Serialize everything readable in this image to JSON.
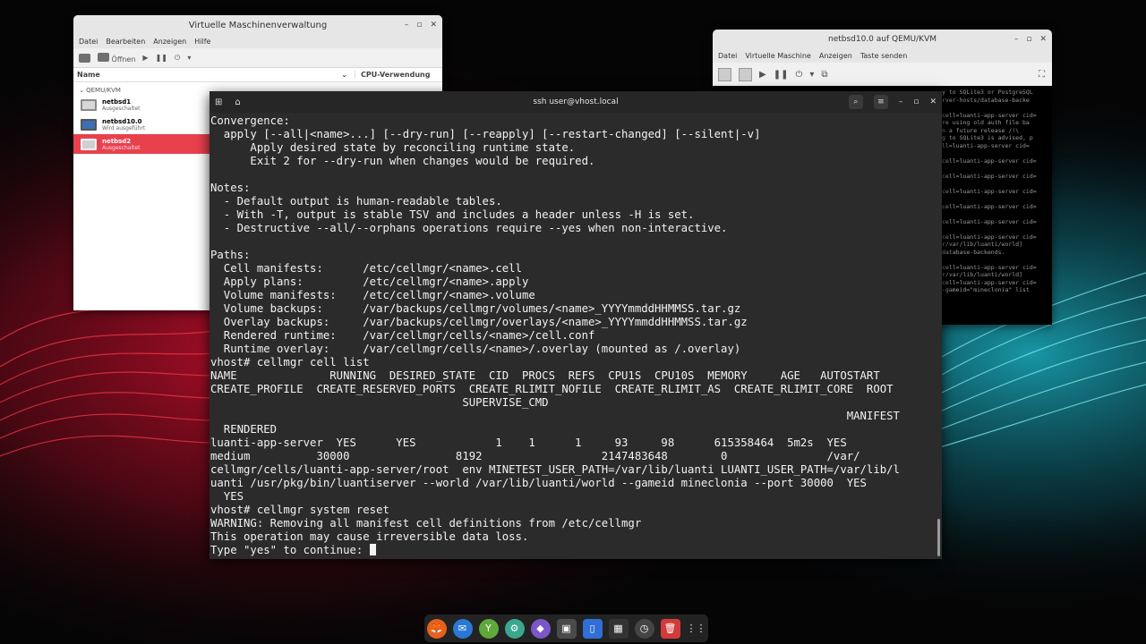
{
  "vmm": {
    "title": "Virtuelle Maschinenverwaltung",
    "menu": [
      "Datei",
      "Bearbeiten",
      "Anzeigen",
      "Hilfe"
    ],
    "toolbar": {
      "open": "Öffnen"
    },
    "columns": {
      "name": "Name",
      "cpu": "CPU-Verwendung"
    },
    "group": "QEMU/KVM",
    "vms": [
      {
        "name": "netbsd1",
        "state": "Ausgeschaltet"
      },
      {
        "name": "netbsd10.0",
        "state": "Wird ausgeführt"
      },
      {
        "name": "netbsd2",
        "state": "Ausgeschaltet"
      }
    ]
  },
  "qemu": {
    "title": "netbsd10.0 auf QEMU/KVM",
    "menu": [
      "Datei",
      "Virtuelle Maschine",
      "Anzeigen",
      "Taste senden"
    ],
    "console_lines": [
      "y to SQLite3 or PostgreSQL",
      "rver-hosts/database-backe",
      "",
      "cell=luanti-app-server cid=",
      "re using old auth file ba",
      "n a future release /!\\",
      "g to SQLite3 is advised, p",
      "ll=luanti-app-server cid=",
      "",
      "cell=luanti-app-server cid=",
      "",
      "cell=luanti-app-server cid=",
      "",
      "cell=luanti-app-server cid=",
      "",
      "cell=luanti-app-server cid=",
      "",
      "cell=luanti-app-server cid=",
      "",
      "cell=luanti-app-server cid=",
      "r/var/lib/luanti/world]",
      "database-backends.",
      "",
      "cell=luanti-app-server cid=",
      "r/var/lib/luanti/world]",
      "cell=luanti-app-server cid=",
      "-gameid=\"mineclonia\" list"
    ]
  },
  "terminal": {
    "title": "ssh user@vhost.local",
    "lines": [
      "Convergence:",
      "  apply [--all|<name>...] [--dry-run] [--reapply] [--restart-changed] [--silent|-v]",
      "      Apply desired state by reconciling runtime state.",
      "      Exit 2 for --dry-run when changes would be required.",
      "",
      "Notes:",
      "  - Default output is human-readable tables.",
      "  - With -T, output is stable TSV and includes a header unless -H is set.",
      "  - Destructive --all/--orphans operations require --yes when non-interactive.",
      "",
      "Paths:",
      "  Cell manifests:      /etc/cellmgr/<name>.cell",
      "  Apply plans:         /etc/cellmgr/<name>.apply",
      "  Volume manifests:    /etc/cellmgr/<name>.volume",
      "  Volume backups:      /var/backups/cellmgr/volumes/<name>_YYYYmmddHHMMSS.tar.gz",
      "  Overlay backups:     /var/backups/cellmgr/overlays/<name>_YYYYmmddHHMMSS.tar.gz",
      "  Rendered runtime:    /var/cellmgr/cells/<name>/cell.conf",
      "  Runtime overlay:     /var/cellmgr/cells/<name>/.overlay (mounted as /.overlay)",
      "vhost# cellmgr cell list",
      "NAME              RUNNING  DESIRED_STATE  CID  PROCS  REFS  CPU1S  CPU10S  MEMORY     AGE   AUTOSTART",
      "CREATE_PROFILE  CREATE_RESERVED_PORTS  CREATE_RLIMIT_NOFILE  CREATE_RLIMIT_AS  CREATE_RLIMIT_CORE  ROOT",
      "                                      SUPERVISE_CMD",
      "                                                                                                MANIFEST",
      "  RENDERED",
      "luanti-app-server  YES      YES            1    1      1     93     98      615358464  5m2s  YES",
      "medium          30000                8192                  2147483648        0               /var/",
      "cellmgr/cells/luanti-app-server/root  env MINETEST_USER_PATH=/var/lib/luanti LUANTI_USER_PATH=/var/lib/l",
      "uanti /usr/pkg/bin/luantiserver --world /var/lib/luanti/world --gameid mineclonia --port 30000  YES",
      "  YES",
      "vhost# cellmgr system reset",
      "WARNING: Removing all manifest cell definitions from /etc/cellmgr",
      "This operation may cause irreversible data loss.",
      "Type \"yes\" to continue: "
    ]
  },
  "colors": {
    "terminal_bg": "#2b2b2b",
    "terminal_fg": "#f2f2f2",
    "selection": "#e8414d"
  },
  "dock": {
    "icons": [
      "firefox-icon",
      "thunderbird-icon",
      "vim-icon",
      "settings-icon",
      "package-icon",
      "terminal-icon",
      "phone-icon",
      "virt-manager-icon",
      "clock-icon",
      "trash-icon",
      "app-grid-icon"
    ]
  }
}
